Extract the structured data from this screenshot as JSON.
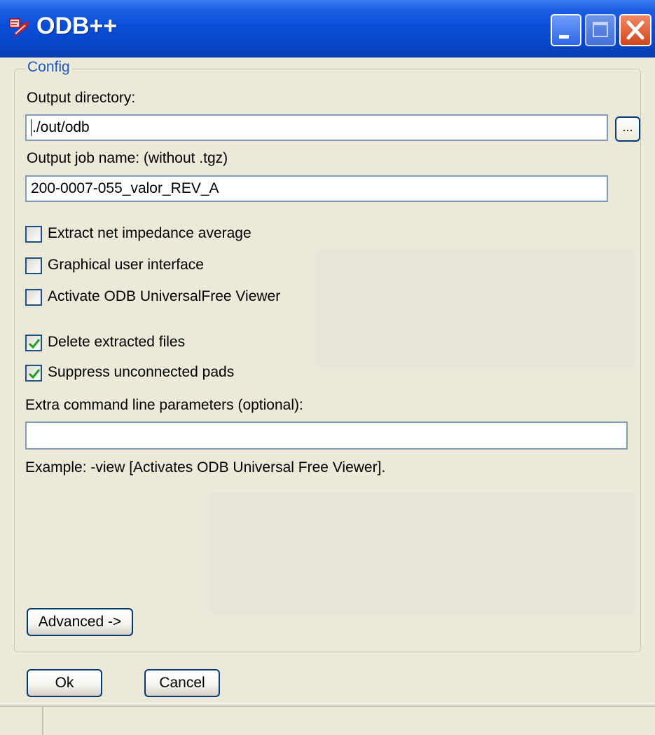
{
  "window": {
    "title": "ODB++",
    "icon": "app-icon",
    "controls": {
      "minimize": "minimize-icon",
      "maximize": "maximize-icon",
      "close": "close-icon"
    }
  },
  "config": {
    "legend": "Config",
    "output_directory_label": "Output directory:",
    "output_directory_value": "./out/odb",
    "browse_label": "...",
    "job_name_label": "Output job name: (without .tgz)",
    "job_name_value": "200-0007-055_valor_REV_A",
    "checkboxes": [
      {
        "label": "Extract net impedance average",
        "checked": false
      },
      {
        "label": "Graphical user interface",
        "checked": false
      },
      {
        "label": "Activate ODB UniversalFree Viewer",
        "checked": false
      },
      {
        "label": "Delete extracted files",
        "checked": true
      },
      {
        "label": "Suppress unconnected pads",
        "checked": true
      }
    ],
    "extra_params_label": "Extra command line parameters (optional):",
    "extra_params_value": "",
    "example_text": "Example: -view [Activates ODB Universal Free Viewer].",
    "advanced_label": "Advanced ->"
  },
  "buttons": {
    "ok": "Ok",
    "cancel": "Cancel"
  },
  "colors": {
    "titlebar": "#0a4ed8",
    "legend": "#1f56c9",
    "dialog_bg": "#ece9d8",
    "check": "#21a121"
  }
}
